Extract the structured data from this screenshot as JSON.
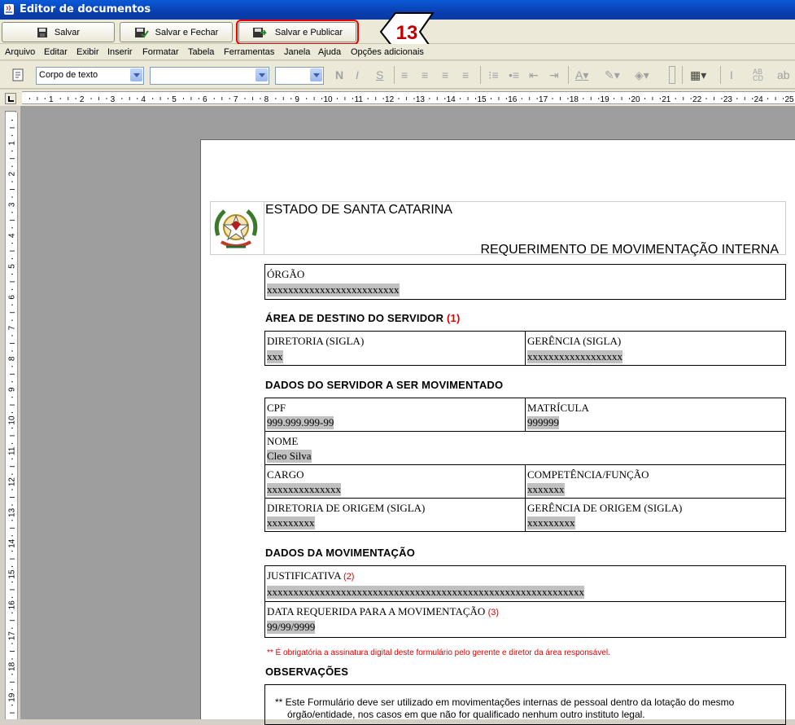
{
  "window": {
    "title": "Editor de documentos"
  },
  "toolbar": {
    "save_label": "Salvar",
    "save_close_label": "Salvar e Fechar",
    "save_publish_label": "Salvar e Publicar",
    "callout_number": "13"
  },
  "menu": {
    "items": [
      "Arquivo",
      "Editar",
      "Exibir",
      "Inserir",
      "Formatar",
      "Tabela",
      "Ferramentas",
      "Janela",
      "Ajuda",
      "Opções adicionais"
    ]
  },
  "format": {
    "style_value": "Corpo de texto",
    "font_value": "",
    "size_value": ""
  },
  "ruler": {
    "h": [
      "1",
      "2",
      "3",
      "4",
      "5",
      "6",
      "7",
      "8",
      "9",
      "10",
      "11",
      "12",
      "13",
      "14",
      "15",
      "16",
      "17",
      "18",
      "19",
      "20",
      "21",
      "22",
      "23",
      "24",
      "25"
    ],
    "v": [
      "1",
      "2",
      "3",
      "4",
      "5",
      "6",
      "7",
      "8",
      "9",
      "10",
      "11",
      "12",
      "13",
      "14",
      "15",
      "16",
      "17",
      "18",
      "19"
    ]
  },
  "doc": {
    "state": "ESTADO DE SANTA CATARINA",
    "title": "REQUERIMENTO DE MOVIMENTAÇÃO INTERNA",
    "orgao_label": "ÓRGÃO",
    "orgao_value": "xxxxxxxxxxxxxxxxxxxxxxxxx",
    "sec1_title": "ÁREA DE DESTINO DO SERVIDOR",
    "sec1_note": "(1)",
    "diretoria_label": "DIRETORIA (SIGLA)",
    "diretoria_value": "xxx",
    "gerencia_label": "GERÊNCIA (SIGLA)",
    "gerencia_value": "xxxxxxxxxxxxxxxxxx",
    "sec2_title": "DADOS DO SERVIDOR A SER MOVIMENTADO",
    "cpf_label": "CPF",
    "cpf_value": "999.999.999-99",
    "matricula_label": "MATRÍCULA",
    "matricula_value": "999999",
    "nome_label": "NOME",
    "nome_value": "Cleo Silva",
    "cargo_label": "CARGO",
    "cargo_value": "xxxxxxxxxxxxxx",
    "competencia_label": "COMPETÊNCIA/FUNÇÃO",
    "competencia_value": "xxxxxxx",
    "dir_origem_label": "DIRETORIA DE ORIGEM (SIGLA)",
    "dir_origem_value": "xxxxxxxxx",
    "ger_origem_label": "GERÊNCIA DE ORIGEM (SIGLA)",
    "ger_origem_value": "xxxxxxxxx",
    "sec3_title": "DADOS DA MOVIMENTAÇÃO",
    "justificativa_label": "JUSTIFICATIVA",
    "justificativa_note": "(2)",
    "justificativa_value": "xxxxxxxxxxxxxxxxxxxxxxxxxxxxxxxxxxxxxxxxxxxxxxxxxxxxxxxxxxxx",
    "data_label": "DATA REQUERIDA PARA A MOVIMENTAÇÃO",
    "data_note": "(3)",
    "data_value": "99/99/9999",
    "mandatory_note": "** É obrigatória a assinatura digital deste formulário pelo gerente e diretor da área responsável.",
    "obs_title": "OBSERVAÇÕES",
    "obs_line1": "** Este Formulário deve ser utilizado em movimentações internas de pessoal dentro da lotação do mesmo",
    "obs_line2": "órgão/entidade, nos casos em que não for qualificado nenhum outro instituto legal."
  },
  "colors": {
    "titlebar": "#0a3fb0",
    "highlight": "#e00000",
    "field": "#c0c0c0"
  }
}
